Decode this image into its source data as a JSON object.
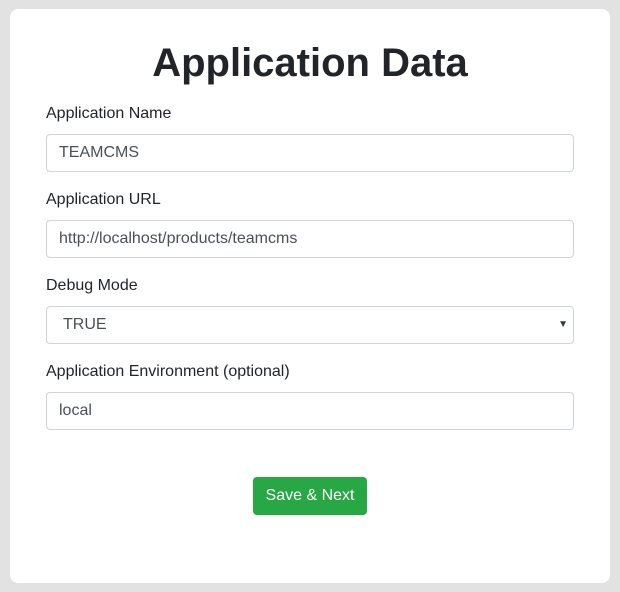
{
  "page": {
    "title": "Application Data"
  },
  "form": {
    "app_name": {
      "label": "Application Name",
      "value": "TEAMCMS"
    },
    "app_url": {
      "label": "Application URL",
      "value": "http://localhost/products/teamcms"
    },
    "debug_mode": {
      "label": "Debug Mode",
      "value": "TRUE",
      "caret_icon": "chevron-down-icon"
    },
    "app_env": {
      "label": "Application Environment (optional)",
      "value": "local"
    },
    "submit_label": "Save & Next"
  },
  "colors": {
    "background": "#e2e2e2",
    "card": "#ffffff",
    "primary_button": "#28a745",
    "input_border": "#ced4da",
    "text": "#212529"
  }
}
